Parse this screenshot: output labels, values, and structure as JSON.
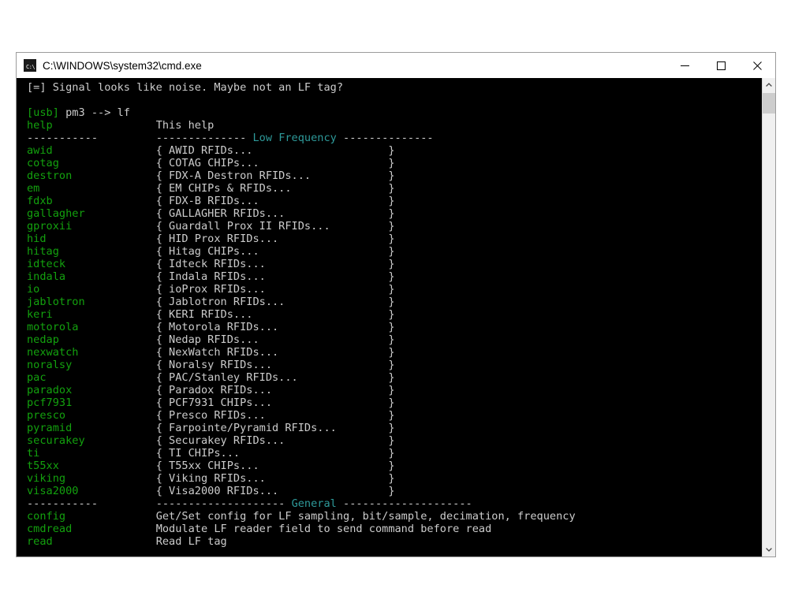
{
  "window": {
    "title": "C:\\WINDOWS\\system32\\cmd.exe",
    "icon": "cmd-console-icon",
    "icon_prompt": "C:\\",
    "controls": {
      "minimize": "minimize-button",
      "maximize": "maximize-button",
      "close": "close-button"
    }
  },
  "colors": {
    "background": "#000000",
    "text": "#cccccc",
    "command": "#13a10e",
    "heading": "#2e9a9a",
    "prompt_bracket": "#13a10e",
    "titlebar": "#ffffff",
    "scrollbar_track": "#f0f0f0",
    "scrollbar_thumb": "#cdcdcd"
  },
  "console": {
    "status_line": "[=] Signal looks like noise. Maybe not an LF tag?",
    "blank_after_status": "",
    "prompt": {
      "bracket": "[usb]",
      "rest": " pm3 --> lf"
    },
    "help_row": {
      "command": "help",
      "description": "This help"
    },
    "separator_left": "-----------",
    "lf_header": {
      "dashes_left": "--------------",
      "title": "Low Frequency",
      "dashes_right": "--------------"
    },
    "general_header": {
      "dashes_left": "--------------------",
      "title": "General",
      "dashes_right": "--------------------"
    },
    "lf_commands": [
      {
        "command": "awid",
        "description": "AWID RFIDs..."
      },
      {
        "command": "cotag",
        "description": "COTAG CHIPs..."
      },
      {
        "command": "destron",
        "description": "FDX-A Destron RFIDs..."
      },
      {
        "command": "em",
        "description": "EM CHIPs & RFIDs..."
      },
      {
        "command": "fdxb",
        "description": "FDX-B RFIDs..."
      },
      {
        "command": "gallagher",
        "description": "GALLAGHER RFIDs..."
      },
      {
        "command": "gproxii",
        "description": "Guardall Prox II RFIDs..."
      },
      {
        "command": "hid",
        "description": "HID Prox RFIDs..."
      },
      {
        "command": "hitag",
        "description": "Hitag CHIPs..."
      },
      {
        "command": "idteck",
        "description": "Idteck RFIDs..."
      },
      {
        "command": "indala",
        "description": "Indala RFIDs..."
      },
      {
        "command": "io",
        "description": "ioProx RFIDs..."
      },
      {
        "command": "jablotron",
        "description": "Jablotron RFIDs..."
      },
      {
        "command": "keri",
        "description": "KERI RFIDs..."
      },
      {
        "command": "motorola",
        "description": "Motorola RFIDs..."
      },
      {
        "command": "nedap",
        "description": "Nedap RFIDs..."
      },
      {
        "command": "nexwatch",
        "description": "NexWatch RFIDs..."
      },
      {
        "command": "noralsy",
        "description": "Noralsy RFIDs..."
      },
      {
        "command": "pac",
        "description": "PAC/Stanley RFIDs..."
      },
      {
        "command": "paradox",
        "description": "Paradox RFIDs..."
      },
      {
        "command": "pcf7931",
        "description": "PCF7931 CHIPs..."
      },
      {
        "command": "presco",
        "description": "Presco RFIDs..."
      },
      {
        "command": "pyramid",
        "description": "Farpointe/Pyramid RFIDs..."
      },
      {
        "command": "securakey",
        "description": "Securakey RFIDs..."
      },
      {
        "command": "ti",
        "description": "TI CHIPs..."
      },
      {
        "command": "t55xx",
        "description": "T55xx CHIPs..."
      },
      {
        "command": "viking",
        "description": "Viking RFIDs..."
      },
      {
        "command": "visa2000",
        "description": "Visa2000 RFIDs..."
      }
    ],
    "general_commands": [
      {
        "command": "config",
        "description": "Get/Set config for LF sampling, bit/sample, decimation, frequency"
      },
      {
        "command": "cmdread",
        "description": "Modulate LF reader field to send command before read"
      },
      {
        "command": "read",
        "description": "Read LF tag"
      }
    ]
  },
  "scrollbar": {
    "up_arrow": "scroll-up-icon",
    "down_arrow": "scroll-down-icon",
    "thumb": "scrollbar-thumb"
  }
}
